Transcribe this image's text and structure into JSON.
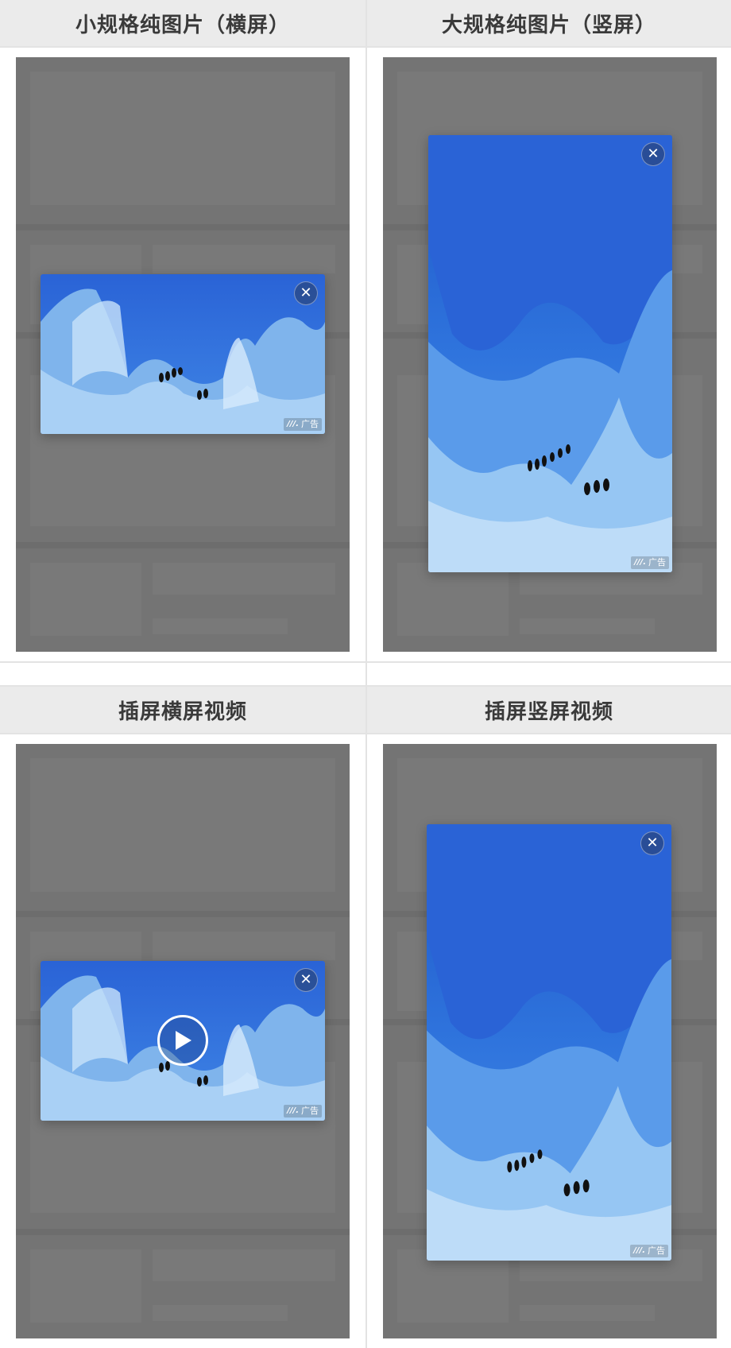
{
  "cells": [
    {
      "title": "小规格纯图片（横屏）"
    },
    {
      "title": "大规格纯图片（竖屏）"
    },
    {
      "title": "插屏横屏视频"
    },
    {
      "title": "插屏竖屏视频"
    }
  ],
  "ad": {
    "badge_label": "广告",
    "close_glyph": "✕",
    "close_icon": "close-icon",
    "play_icon": "play-icon"
  },
  "colors": {
    "header_bg": "#ebebeb",
    "mask": "#747474",
    "ice_dark": "#1f5fc9",
    "ice_light": "#8fc1f2"
  }
}
